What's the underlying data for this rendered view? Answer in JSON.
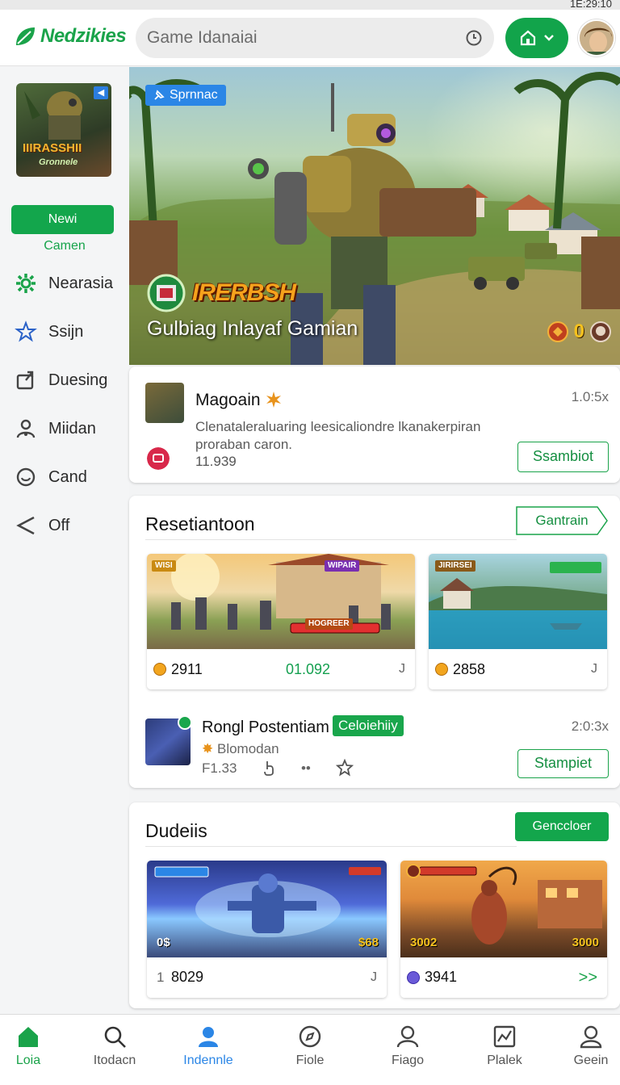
{
  "status": {
    "time": "1E:29:10"
  },
  "header": {
    "logo": "Nedzikies",
    "search_placeholder": "Game Idanaiai"
  },
  "sidebar": {
    "thumb_title": "IIIRASSHII",
    "thumb_sub": "Gronnele",
    "new_button": "Newi",
    "camen": "Camen",
    "items": [
      {
        "label": "Nearasia",
        "icon": "gear-icon"
      },
      {
        "label": "Ssijn",
        "icon": "star-icon"
      },
      {
        "label": "Duesing",
        "icon": "export-icon"
      },
      {
        "label": "Miidan",
        "icon": "user-group-icon"
      },
      {
        "label": "Cand",
        "icon": "smiley-icon"
      },
      {
        "label": "Off",
        "icon": "share-icon"
      }
    ]
  },
  "hero": {
    "tag": "Sprnnac",
    "logo_text": "IRERBSH",
    "subtitle": "Gulbiag Inlayaf Gamian",
    "count": "0"
  },
  "featured": {
    "title": "Magoain",
    "meta": "1.0:5x",
    "description": "Clenataleraluaring leesicaliondre lkanakerpiran proraban caron.",
    "count": "11.939",
    "button": "Ssambiot"
  },
  "section2": {
    "title": "Resetiantoon",
    "more_button": "Gantrain",
    "tiles": [
      {
        "value": "2911",
        "value2": "01.092",
        "end": "J",
        "banner": "WISI",
        "banner2": "WIPAIR",
        "banner3": "HOGREER"
      },
      {
        "value": "2858",
        "end": "J",
        "banner": "JIRIRSEI"
      }
    ],
    "row": {
      "title": "Rongl Postentiam",
      "pill": "Celoiehiiy",
      "sub": "Blomodan",
      "f": "F1.33",
      "dots": "••",
      "meta": "2:0:3x",
      "button": "Stampiet"
    }
  },
  "section3": {
    "title": "Dudeiis",
    "button": "Genccloer",
    "tiles": [
      {
        "index": "1",
        "value": "8029",
        "end": "J",
        "img_left": "0$",
        "img_right": "$68"
      },
      {
        "value": "3941",
        "end": ">>",
        "img_left": "3002",
        "img_right": "3000"
      }
    ]
  },
  "bottom_nav": [
    {
      "label": "Loia",
      "icon": "home-icon"
    },
    {
      "label": "Itodacn",
      "icon": "search-icon"
    },
    {
      "label": "Indennle",
      "icon": "person-icon"
    },
    {
      "label": "Fiole",
      "icon": "compass-icon"
    },
    {
      "label": "Fiago",
      "icon": "user-icon"
    },
    {
      "label": "Plalek",
      "icon": "chart-icon"
    },
    {
      "label": "Geein",
      "icon": "profile-icon"
    }
  ],
  "colors": {
    "accent": "#13a64c",
    "blue": "#2b86e6",
    "red": "#d8284a"
  }
}
